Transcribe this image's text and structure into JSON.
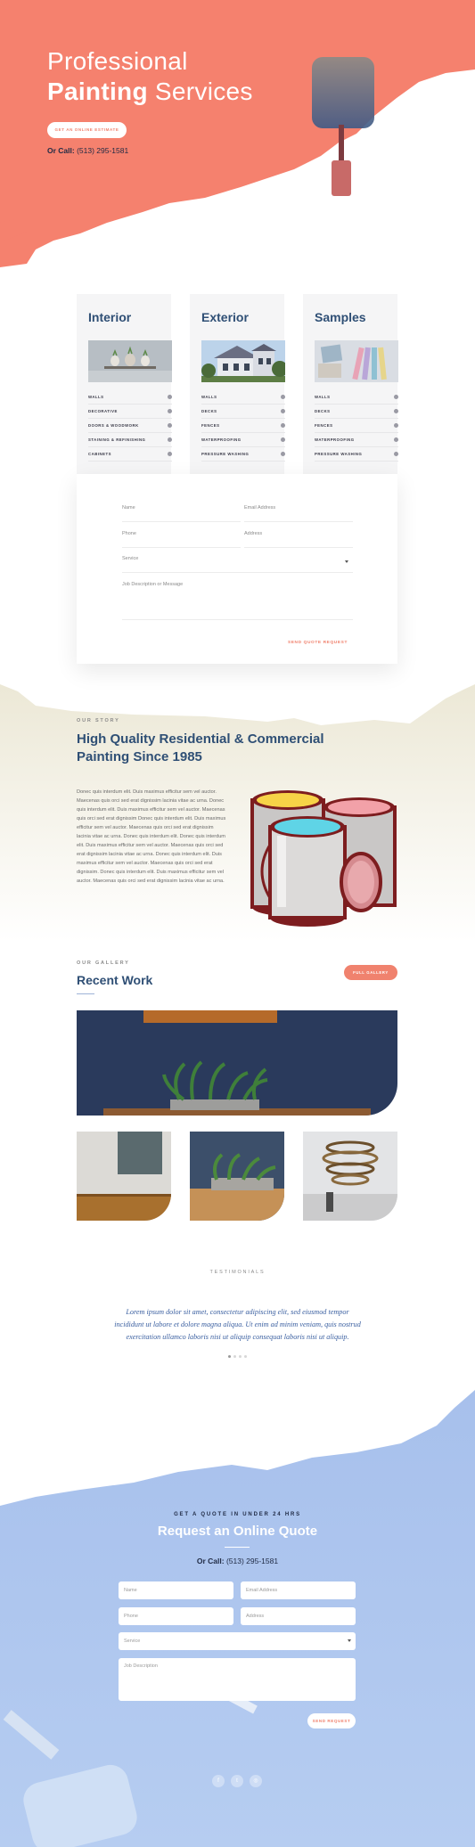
{
  "hero": {
    "title_line1": "Professional",
    "title_bold": "Painting",
    "title_rest": " Services",
    "cta": "GET AN ONLINE ESTIMATE",
    "call_label": "Or Call:",
    "phone": " (513) 295-1581",
    "color": "#f5816e"
  },
  "services": [
    {
      "title": "Interior",
      "items": [
        "WALLS",
        "DECORATIVE",
        "DOORS & WOODWORK",
        "STAINING & REFINISHING",
        "CABINETS"
      ]
    },
    {
      "title": "Exterior",
      "items": [
        "WALLS",
        "DECKS",
        "FENCES",
        "WATERPROOFING",
        "PRESSURE WASHING"
      ]
    },
    {
      "title": "Samples",
      "items": [
        "WALLS",
        "DECKS",
        "FENCES",
        "WATERPROOFING",
        "PRESSURE WASHING"
      ]
    }
  ],
  "form1": {
    "name": "Name",
    "email": "Email Address",
    "phone": "Phone",
    "address": "Address",
    "service": "Service",
    "message": "Job Description or Message",
    "send": "SEND QUOTE REQUEST"
  },
  "story": {
    "eyebrow": "OUR STORY",
    "title": "High Quality Residential & Commercial Painting Since 1985",
    "text": "Donec quis interdum elit. Duis maximus efficitur sem vel auctor. Maecenas quis orci sed erat dignissim lacinia vitae ac urna. Donec quis interdum elit. Duis maximus efficitur sem vel auctor. Maecenas quis orci sed erat dignissim Donec quis interdum elit. Duis maximus efficitur sem vel auctor. Maecenas quis orci sed erat dignissim lacinia vitae ac urna. Donec quis interdum elit. Donec quis interdum elit. Duis maximus efficitur sem vel auctor. Maecenas quis orci sed erat dignissim lacinia vitae ac urna. Donec quis interdum elit. Duis maximus efficitur sem vel auctor. Maecenas quis orci sed erat dignissim. Donec quis interdum elit. Duis maximus efficitur sem vel auctor. Maecenas quis orci sed erat dignissim lacinia vitae ac urna."
  },
  "recent": {
    "eyebrow": "OUR GALLERY",
    "title": "Recent Work",
    "button": "FULL GALLERY"
  },
  "testimonials": {
    "eyebrow": "TESTIMONIALS",
    "quote": "Lorem ipsum dolor sit amet, consectetur adipiscing elit, sed eiusmod tempor incididunt ut labore et dolore magna aliqua. Ut enim ad minim veniam, quis nostrud exercitation ullamco laboris nisi ut aliquip consequat laboris nisi ut aliquip."
  },
  "bottom_quote": {
    "eyebrow": "GET A QUOTE IN UNDER 24 HRS",
    "title": "Request an Online Quote",
    "call_label": "Or Call:",
    "phone": " (513) 295-1581",
    "name": "Name",
    "email": "Email Address",
    "phone_field": "Phone",
    "address": "Address",
    "service": "Service",
    "description": "Job Description",
    "send": "SEND REQUEST",
    "color": "#a9c4ee"
  },
  "social": [
    {
      "icon": "facebook-icon",
      "glyph": "f"
    },
    {
      "icon": "twitter-icon",
      "glyph": "t"
    },
    {
      "icon": "instagram-icon",
      "glyph": "◎"
    }
  ]
}
